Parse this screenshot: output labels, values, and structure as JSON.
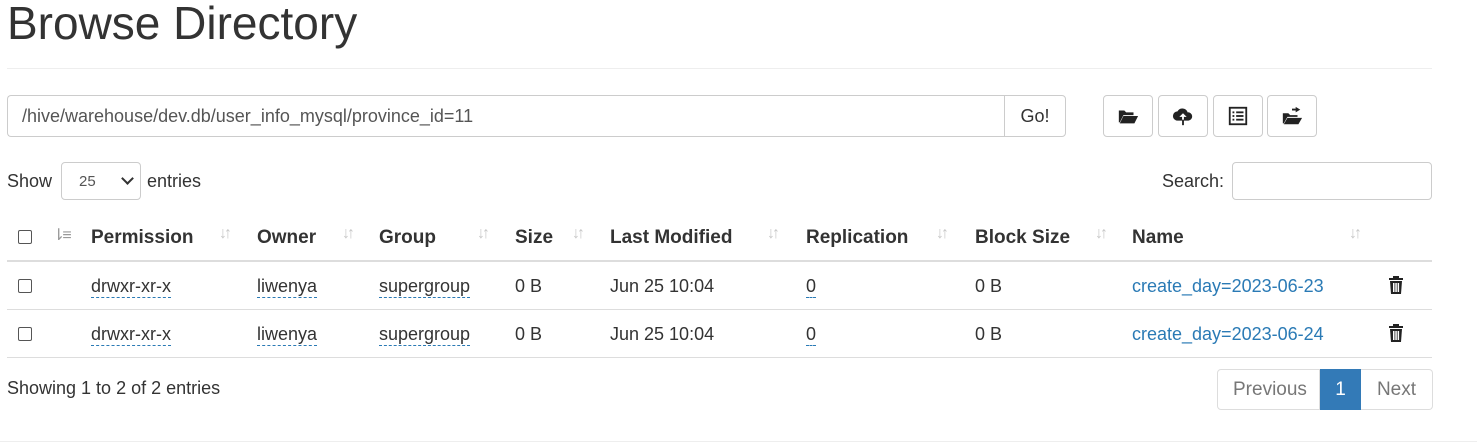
{
  "page": {
    "title": "Browse Directory"
  },
  "pathbar": {
    "path": "/hive/warehouse/dev.db/user_info_mysql/province_id=11",
    "go_label": "Go!"
  },
  "toolbar": {
    "icons": [
      "folder-open-icon",
      "cloud-upload-icon",
      "list-alt-icon",
      "cut-paste-icon"
    ]
  },
  "controls": {
    "show_label": "Show",
    "page_size": "25",
    "entries_label": "entries",
    "search_label": "Search:",
    "search_value": ""
  },
  "table": {
    "columns": [
      "Permission",
      "Owner",
      "Group",
      "Size",
      "Last Modified",
      "Replication",
      "Block Size",
      "Name"
    ],
    "rows": [
      {
        "permission": "drwxr-xr-x",
        "owner": "liwenya",
        "group": "supergroup",
        "size": "0 B",
        "last_modified": "Jun 25 10:04",
        "replication": "0",
        "block_size": "0 B",
        "name": "create_day=2023-06-23"
      },
      {
        "permission": "drwxr-xr-x",
        "owner": "liwenya",
        "group": "supergroup",
        "size": "0 B",
        "last_modified": "Jun 25 10:04",
        "replication": "0",
        "block_size": "0 B",
        "name": "create_day=2023-06-24"
      }
    ]
  },
  "footer": {
    "info": "Showing 1 to 2 of 2 entries",
    "previous": "Previous",
    "current_page": "1",
    "next": "Next"
  },
  "colors": {
    "link": "#2a7ab5",
    "active_page": "#337ab7"
  }
}
